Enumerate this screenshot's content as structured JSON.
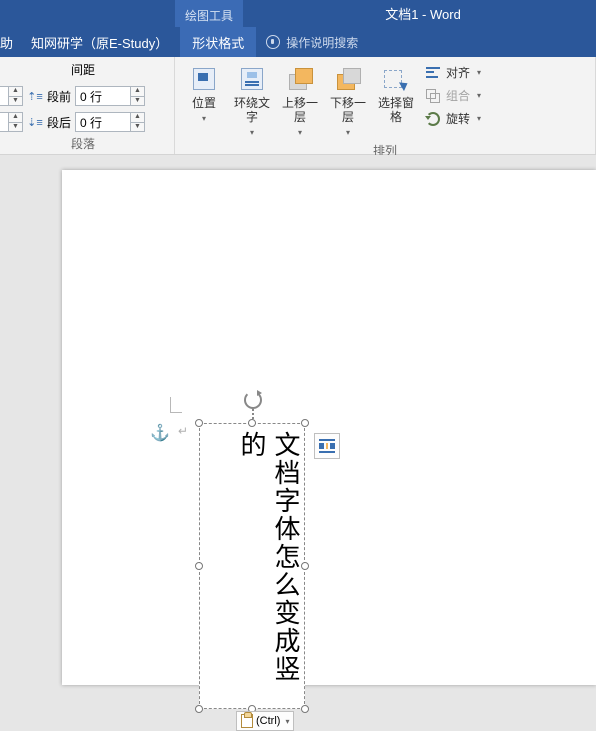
{
  "titlebar": {
    "context_tab": "绘图工具",
    "doc_title": "文档1 - Word"
  },
  "tabs": {
    "help": "助",
    "zhiwang": "知网研学（原E-Study）",
    "shape_format": "形状格式",
    "tell_me": "操作说明搜索"
  },
  "ribbon": {
    "spacing": {
      "title": "间距",
      "before_label": "段前",
      "before_value": "0 行",
      "after_label": "段后",
      "after_value": "0 行",
      "indent_left_value": "",
      "group_label": "段落"
    },
    "arrange": {
      "position": "位置",
      "wrap": "环绕文字",
      "bring_forward": "上移一层",
      "send_backward": "下移一层",
      "selection_pane": "选择窗格",
      "align": "对齐",
      "group": "组合",
      "rotate": "旋转",
      "group_label": "排列"
    }
  },
  "canvas": {
    "textbox_content": "文档字体怎么变成竖的",
    "paste_tag": "(Ctrl)"
  }
}
